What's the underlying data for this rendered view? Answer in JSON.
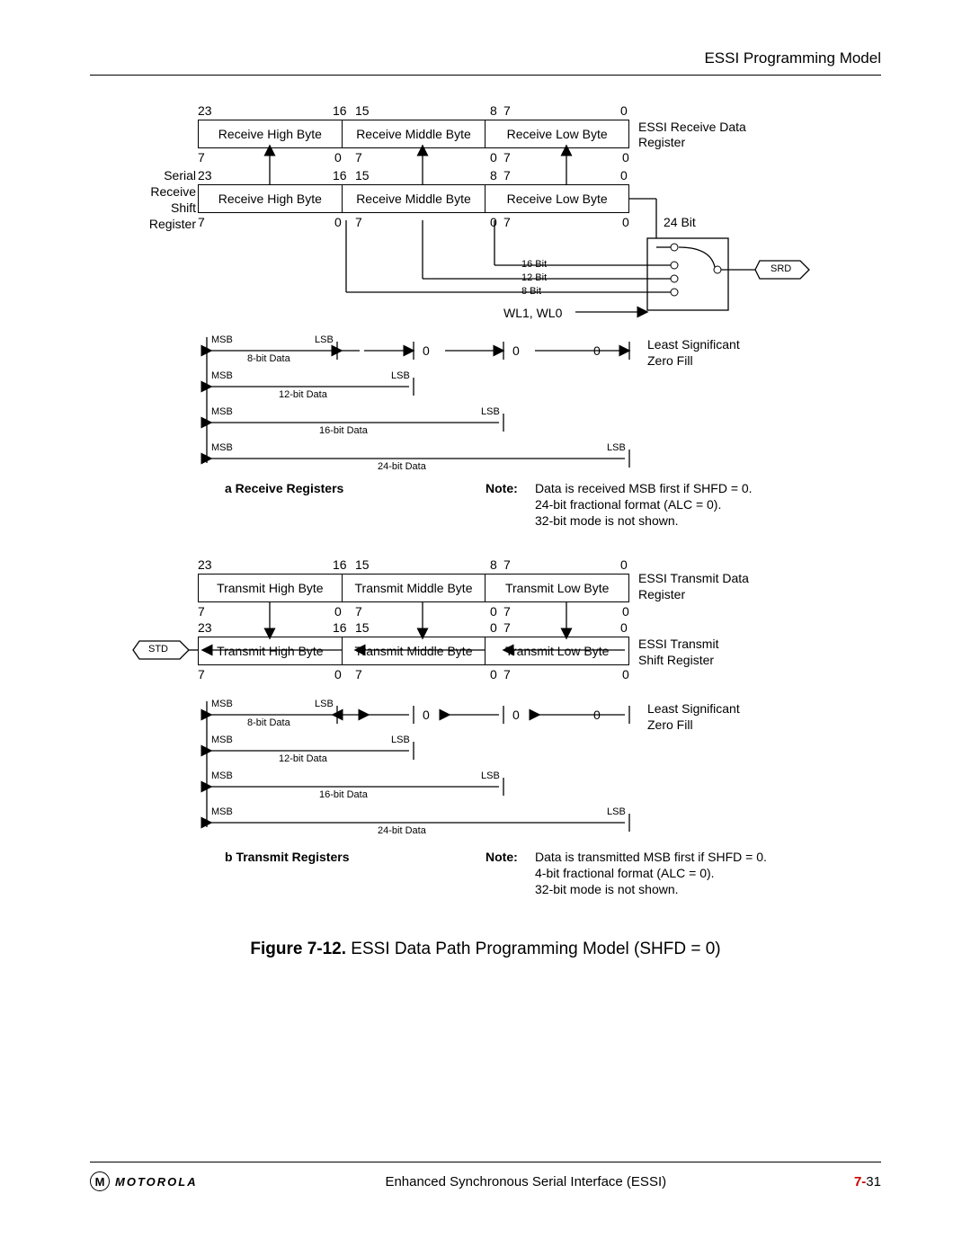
{
  "header": {
    "title": "ESSI Programming Model"
  },
  "diagram_a": {
    "top_bits": {
      "b23": "23",
      "b16": "16",
      "b15": "15",
      "b8": "8",
      "b7": "7",
      "b0": "0"
    },
    "rx_data_reg": {
      "high": "Receive High Byte",
      "mid": "Receive Middle Byte",
      "low": "Receive Low Byte",
      "label1": "ESSI Receive Data",
      "label2": "Register"
    },
    "under_bits": {
      "l7": "7",
      "l0": "0",
      "m7": "7",
      "m0": "0",
      "r7": "7",
      "r0": "0"
    },
    "shift_label1": "Serial",
    "shift_label2": "Receive",
    "shift_label3": "Shift",
    "shift_label4": "Register",
    "rx_shift_reg": {
      "high": "Receive High Byte",
      "mid": "Receive Middle Byte",
      "low": "Receive Low Byte"
    },
    "bits24": "24 Bit",
    "bits16": "16 Bit",
    "bits12": "12 Bit",
    "bits8": "8 Bit",
    "wl": "WL1, WL0",
    "srd": "SRD",
    "msb": "MSB",
    "lsb": "LSB",
    "d8": "8-bit Data",
    "d12": "12-bit Data",
    "d16": "16-bit Data",
    "d24": "24-bit Data",
    "zero": "0",
    "lszf1": "Least Significant",
    "lszf2": "Zero Fill",
    "section_label": "a Receive Registers",
    "note_label": "Note:",
    "note_l1": "Data is received MSB first if SHFD = 0.",
    "note_l2": "24-bit fractional format (ALC = 0).",
    "note_l3": "32-bit mode is not shown."
  },
  "diagram_b": {
    "top_bits": {
      "b23": "23",
      "b16": "16",
      "b15": "15",
      "b8": "8",
      "b7": "7",
      "b0": "0"
    },
    "tx_data_reg": {
      "high": "Transmit High Byte",
      "mid": "Transmit Middle Byte",
      "low": "Transmit Low Byte",
      "label1": "ESSI Transmit Data",
      "label2": "Register"
    },
    "under_bits": {
      "l7": "7",
      "l0": "0",
      "m7": "7",
      "m0": "0",
      "r7": "7",
      "r0": "0"
    },
    "tx_shift_reg": {
      "high": "Transmit High Byte",
      "mid": "Transmit Middle Byte",
      "low": "Transmit Low Byte",
      "label1": "ESSI Transmit",
      "label2": "Shift Register"
    },
    "std": "STD",
    "msb": "MSB",
    "lsb": "LSB",
    "d8": "8-bit Data",
    "d12": "12-bit Data",
    "d16": "16-bit Data",
    "d24": "24-bit Data",
    "zero": "0",
    "lszf1": "Least Significant",
    "lszf2": "Zero Fill",
    "section_label": "b Transmit Registers",
    "note_label": "Note:",
    "note_l1": "Data is transmitted MSB first if SHFD = 0.",
    "note_l2": "4-bit fractional format (ALC = 0).",
    "note_l3": "32-bit mode is not shown."
  },
  "caption": {
    "bold": "Figure 7-12.",
    "rest": " ESSI Data Path Programming Model (SHFD = 0)"
  },
  "footer": {
    "brand": "MOTOROLA",
    "center": "Enhanced Synchronous Serial Interface (ESSI)",
    "page_prefix": "7-",
    "page_num": "31"
  }
}
